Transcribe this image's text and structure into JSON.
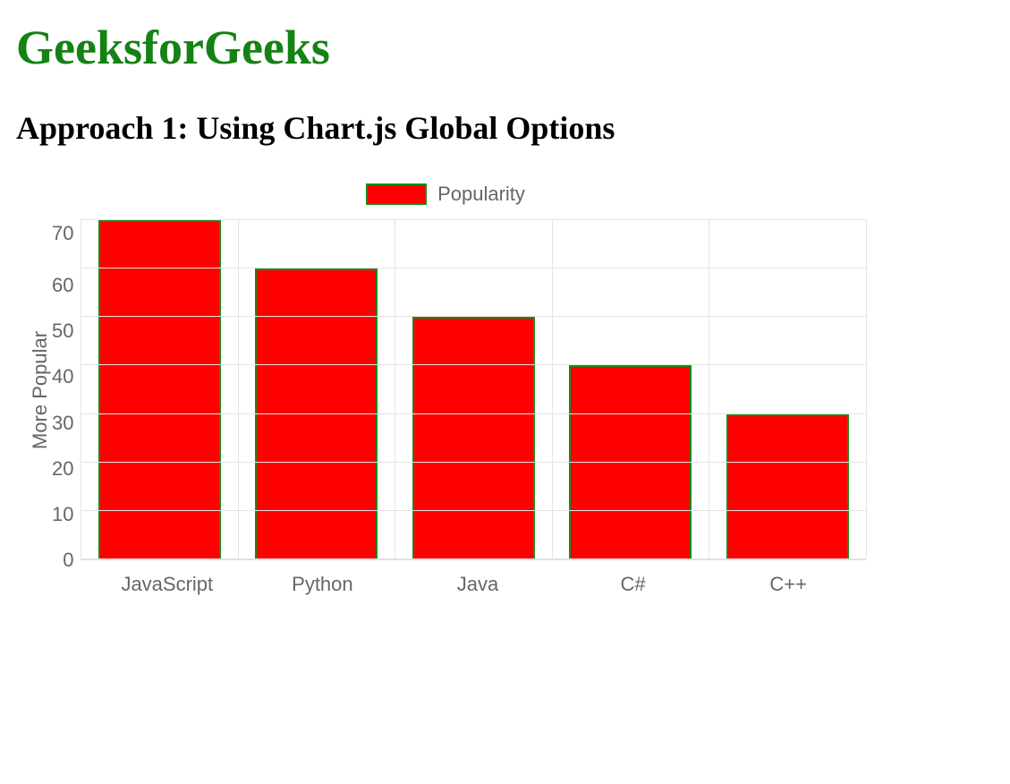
{
  "page": {
    "title": "GeeksforGeeks",
    "subtitle": "Approach 1: Using Chart.js Global Options"
  },
  "chart_data": {
    "type": "bar",
    "categories": [
      "JavaScript",
      "Python",
      "Java",
      "C#",
      "C++"
    ],
    "values": [
      70,
      60,
      50,
      40,
      30
    ],
    "title": "",
    "xlabel": "",
    "ylabel": "More Popular",
    "ylim": [
      0,
      70
    ],
    "ystep": 10,
    "legend": "Popularity",
    "bar_color": "#ff0000",
    "bar_border": "#1a8a1a"
  }
}
